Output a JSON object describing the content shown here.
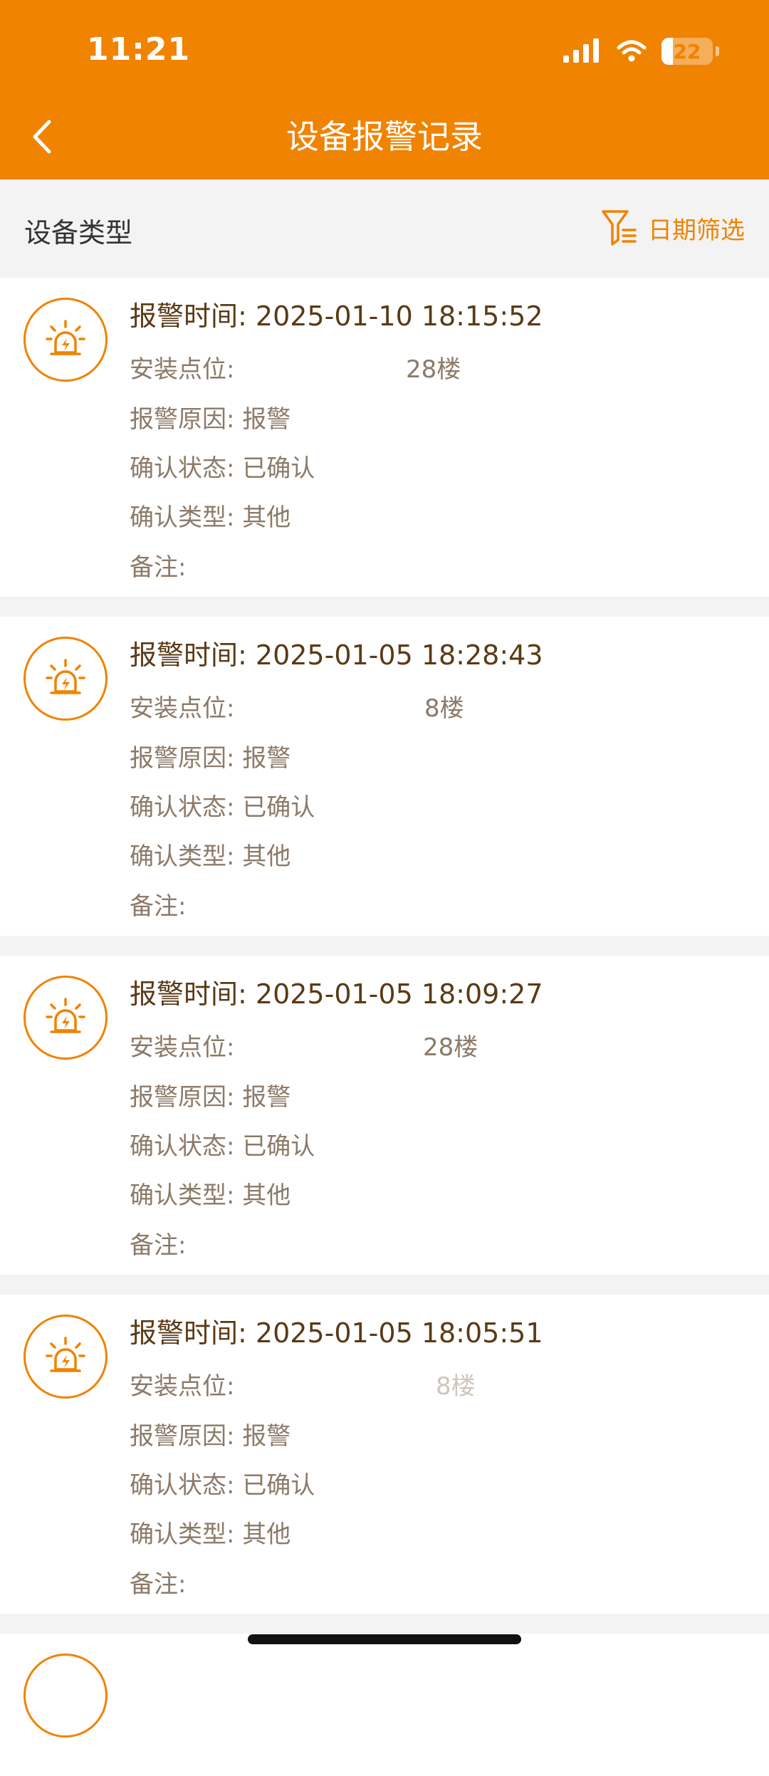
{
  "status_bar": {
    "time": "11:21",
    "battery": "22",
    "battery_level": 0.22
  },
  "header": {
    "title": "设备报警记录",
    "back_icon": "chevron-left-icon"
  },
  "filter_bar": {
    "device_type_label": "设备类型",
    "date_filter_label": "日期筛选",
    "filter_icon": "funnel-icon"
  },
  "labels": {
    "alarm_time": "报警时间:",
    "location": "安装点位:",
    "reason": "报警原因:",
    "confirm_status": "确认状态:",
    "confirm_type": "确认类型:",
    "remark": "备注:"
  },
  "records": [
    {
      "time": "2025-01-10 18:15:52",
      "location_visible": "28楼",
      "reason": "报警",
      "confirm_status": "已确认",
      "confirm_type": "其他",
      "remark": ""
    },
    {
      "time": "2025-01-05 18:28:43",
      "location_visible": "8楼",
      "reason": "报警",
      "confirm_status": "已确认",
      "confirm_type": "其他",
      "remark": ""
    },
    {
      "time": "2025-01-05 18:09:27",
      "location_visible": "28楼",
      "reason": "报警",
      "confirm_status": "已确认",
      "confirm_type": "其他",
      "remark": ""
    },
    {
      "time": "2025-01-05 18:05:51",
      "location_visible": "8楼",
      "reason": "报警",
      "confirm_status": "已确认",
      "confirm_type": "其他",
      "remark": ""
    }
  ],
  "colors": {
    "accent": "#f08300",
    "background": "#f3f3f3",
    "title_text": "#5a3a16",
    "field_text": "#8c7a68"
  }
}
